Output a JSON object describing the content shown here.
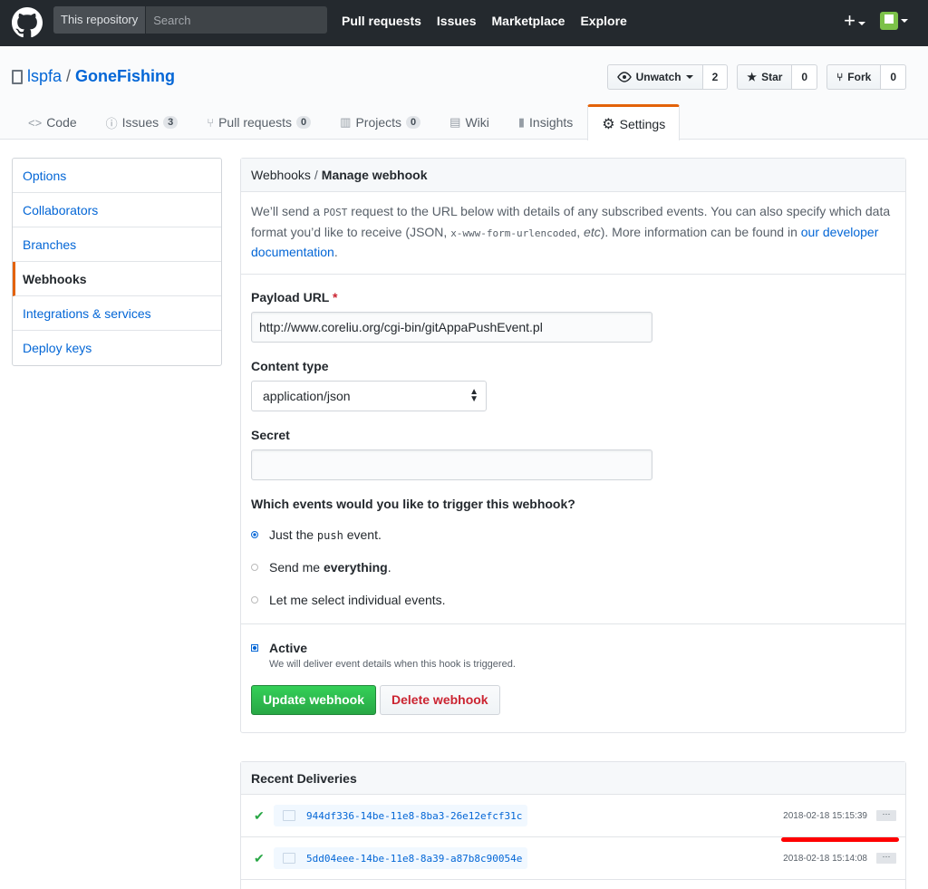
{
  "header": {
    "search_scope": "This repository",
    "search_placeholder": "Search",
    "nav": [
      "Pull requests",
      "Issues",
      "Marketplace",
      "Explore"
    ],
    "plus_label": "+"
  },
  "repo": {
    "owner": "lspfa",
    "separator": "/",
    "name": "GoneFishing",
    "actions": {
      "watch_label": "Unwatch",
      "watch_count": "2",
      "star_label": "Star",
      "star_count": "0",
      "fork_label": "Fork",
      "fork_count": "0"
    },
    "tabs": [
      {
        "label": "Code",
        "icon": "code-icon",
        "glyph": "<>"
      },
      {
        "label": "Issues",
        "count": "3",
        "icon": "issue-icon",
        "glyph": "ⓘ"
      },
      {
        "label": "Pull requests",
        "count": "0",
        "icon": "pull-request-icon",
        "glyph": "⑂"
      },
      {
        "label": "Projects",
        "count": "0",
        "icon": "project-icon",
        "glyph": "▥"
      },
      {
        "label": "Wiki",
        "icon": "wiki-icon",
        "glyph": "▤"
      },
      {
        "label": "Insights",
        "icon": "graph-icon",
        "glyph": "▮"
      },
      {
        "label": "Settings",
        "icon": "gear-icon",
        "glyph": "⚙"
      }
    ]
  },
  "sidebar": {
    "items": [
      "Options",
      "Collaborators",
      "Branches",
      "Webhooks",
      "Integrations & services",
      "Deploy keys"
    ]
  },
  "webhook": {
    "breadcrumb_parent": "Webhooks",
    "breadcrumb_sep": "/",
    "breadcrumb_current": "Manage webhook",
    "intro_1": "We’ll send a ",
    "intro_code1": "POST",
    "intro_2": " request to the URL below with details of any subscribed events. You can also specify which data format you’d like to receive (JSON, ",
    "intro_code2": "x-www-form-urlencoded",
    "intro_3": ", ",
    "intro_etc": "etc",
    "intro_4": "). More information can be found in ",
    "intro_link": "our developer documentation",
    "intro_5": ".",
    "payload_label": "Payload URL",
    "payload_required": "*",
    "payload_value": "http://www.coreliu.org/cgi-bin/gitAppaPushEvent.pl",
    "content_type_label": "Content type",
    "content_type_value": "application/json",
    "secret_label": "Secret",
    "secret_value": "",
    "events_question": "Which events would you like to trigger this webhook?",
    "event_push_a": "Just the ",
    "event_push_code": "push",
    "event_push_b": " event.",
    "event_all_a": "Send me ",
    "event_all_b": "everything",
    "event_all_c": ".",
    "event_select": "Let me select individual events.",
    "active_label": "Active",
    "active_note": "We will deliver event details when this hook is triggered.",
    "update_button": "Update webhook",
    "delete_button": "Delete webhook"
  },
  "deliveries": {
    "title": "Recent Deliveries",
    "items": [
      {
        "guid": "944df336-14be-11e8-8ba3-26e12efcf31c",
        "time": "2018-02-18 15:15:39"
      },
      {
        "guid": "5dd04eee-14be-11e8-8a39-a87b8c90054e",
        "time": "2018-02-18 15:14:08"
      }
    ],
    "more_label": "···"
  },
  "colors": {
    "accent": "#e36209",
    "link": "#0366d6",
    "primary_button": "#28a745",
    "danger_text": "#cb2431",
    "annotation": "#ff0000"
  }
}
